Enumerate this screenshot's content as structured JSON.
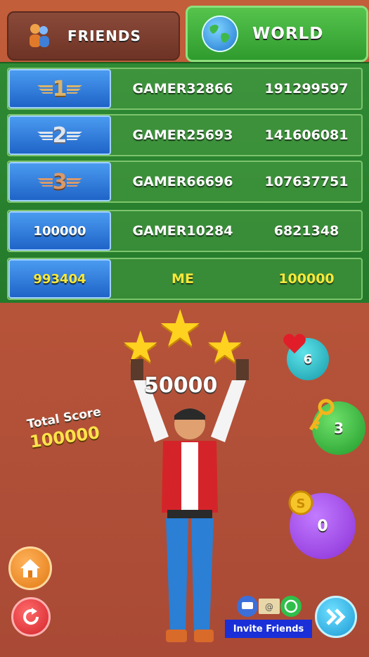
{
  "tabs": {
    "friends": "FRIENDS",
    "world": "WORLD"
  },
  "leaderboard": [
    {
      "rank": "1",
      "medal": "gold",
      "name": "GAMER32866",
      "score": "191299597"
    },
    {
      "rank": "2",
      "medal": "silver",
      "name": "GAMER25693",
      "score": "141606081"
    },
    {
      "rank": "3",
      "medal": "bronze",
      "name": "GAMER66696",
      "score": "107637751"
    },
    {
      "rank": "100000",
      "name": "GAMER10284",
      "score": "6821348"
    },
    {
      "rank": "993404",
      "name": "ME",
      "score": "100000"
    }
  ],
  "result": {
    "stars": 3,
    "round_score": "50000",
    "total_label": "Total Score",
    "total_value": "100000"
  },
  "resources": {
    "lives": "6",
    "keys": "3",
    "coins": "0"
  },
  "invite_label": "Invite Friends",
  "colors": {
    "accent_green": "#2f9b2e",
    "me_text": "#f7e83a",
    "star": "#ffd21f"
  },
  "icons": [
    "people-icon",
    "globe-icon",
    "heart-icon",
    "key-icon",
    "coin-icon",
    "home-icon",
    "retry-icon",
    "forward-icon",
    "chat-icon",
    "email-icon",
    "whatsapp-icon"
  ]
}
